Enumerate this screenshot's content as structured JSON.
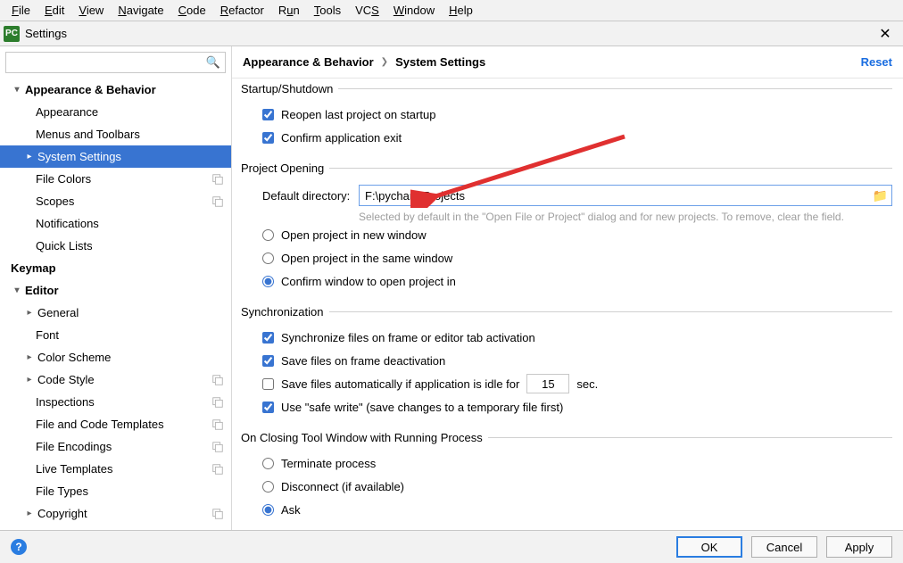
{
  "menu": [
    "File",
    "Edit",
    "View",
    "Navigate",
    "Code",
    "Refactor",
    "Run",
    "Tools",
    "VCS",
    "Window",
    "Help"
  ],
  "window_title": "Settings",
  "app_icon_text": "PC",
  "search_placeholder": "",
  "sidebar": {
    "items": [
      {
        "label": "Appearance & Behavior",
        "level": 0,
        "chevron": "down",
        "bold": true
      },
      {
        "label": "Appearance",
        "level": 1
      },
      {
        "label": "Menus and Toolbars",
        "level": 1
      },
      {
        "label": "System Settings",
        "level": 1,
        "selected": true,
        "chevron": "right"
      },
      {
        "label": "File Colors",
        "level": 1,
        "badge": true
      },
      {
        "label": "Scopes",
        "level": 1,
        "badge": true
      },
      {
        "label": "Notifications",
        "level": 1
      },
      {
        "label": "Quick Lists",
        "level": 1
      },
      {
        "label": "Keymap",
        "level": 0,
        "bold": true,
        "chevron": "none"
      },
      {
        "label": "Editor",
        "level": 0,
        "chevron": "down",
        "bold": true
      },
      {
        "label": "General",
        "level": 1,
        "chevron": "right"
      },
      {
        "label": "Font",
        "level": 1
      },
      {
        "label": "Color Scheme",
        "level": 1,
        "chevron": "right"
      },
      {
        "label": "Code Style",
        "level": 1,
        "chevron": "right",
        "badge": true
      },
      {
        "label": "Inspections",
        "level": 1,
        "badge": true
      },
      {
        "label": "File and Code Templates",
        "level": 1,
        "badge": true
      },
      {
        "label": "File Encodings",
        "level": 1,
        "badge": true
      },
      {
        "label": "Live Templates",
        "level": 1,
        "badge": true
      },
      {
        "label": "File Types",
        "level": 1
      },
      {
        "label": "Copyright",
        "level": 1,
        "chevron": "right",
        "badge": true
      }
    ]
  },
  "breadcrumb": {
    "part1": "Appearance & Behavior",
    "part2": "System Settings"
  },
  "reset_label": "Reset",
  "groups": {
    "startup": {
      "legend": "Startup/Shutdown",
      "reopen_label": "Reopen last project on startup",
      "confirm_exit_label": "Confirm application exit",
      "reopen_checked": true,
      "confirm_exit_checked": true
    },
    "project_opening": {
      "legend": "Project Opening",
      "default_dir_label": "Default directory:",
      "default_dir_value": "F:\\pycharmProjects",
      "hint": "Selected by default in the \"Open File or Project\" dialog and for new projects. To remove, clear the field.",
      "opt_new_window": "Open project in new window",
      "opt_same_window": "Open project in the same window",
      "opt_confirm": "Confirm window to open project in",
      "selected": "confirm"
    },
    "sync": {
      "legend": "Synchronization",
      "sync_frame_label": "Synchronize files on frame or editor tab activation",
      "save_deact_label": "Save files on frame deactivation",
      "auto_save_label_pre": "Save files automatically if application is idle for",
      "auto_save_value": "15",
      "auto_save_label_post": "sec.",
      "safe_write_label": "Use \"safe write\" (save changes to a temporary file first)",
      "sync_frame_checked": true,
      "save_deact_checked": true,
      "auto_save_checked": false,
      "safe_write_checked": true
    },
    "closing": {
      "legend": "On Closing Tool Window with Running Process",
      "terminate_label": "Terminate process",
      "disconnect_label": "Disconnect (if available)",
      "ask_label": "Ask",
      "selected": "ask"
    }
  },
  "buttons": {
    "ok": "OK",
    "cancel": "Cancel",
    "apply": "Apply"
  }
}
